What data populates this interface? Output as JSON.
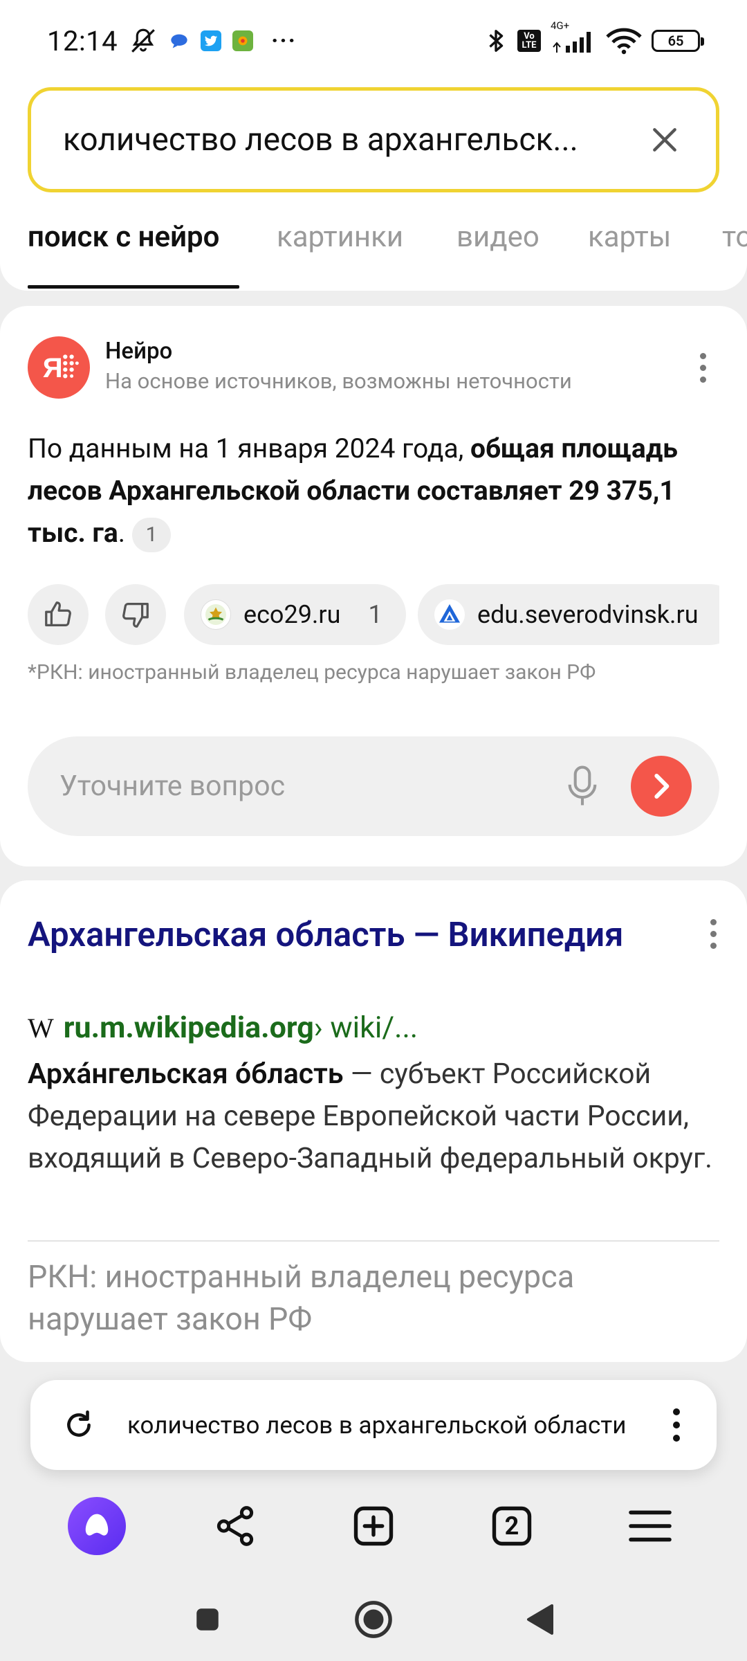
{
  "status_bar": {
    "time": "12:14",
    "net_volte": "Vo LTE",
    "net_type": "4G+",
    "battery": "65",
    "more": "···"
  },
  "search": {
    "query": "количество лесов в архангельск..."
  },
  "tabs": [
    {
      "label": "поиск с нейро"
    },
    {
      "label": "картинки"
    },
    {
      "label": "видео"
    },
    {
      "label": "карты"
    },
    {
      "label": "то"
    }
  ],
  "neuro": {
    "title": "Нейро",
    "subtitle": "На основе источников, возможны неточности",
    "answer_plain": "По данным на 1 января 2024 года, ",
    "answer_bold": "общая площадь лесов Архангельской области составляет 29 375,1 тыс. га",
    "answer_tail": ".",
    "citation": "1",
    "sources": [
      {
        "label": "eco29.ru",
        "count": "1"
      },
      {
        "label": "edu.severodvinsk.ru"
      }
    ],
    "rkn_note": "*РКН: иностранный владелец ресурса нарушает закон РФ",
    "refine_placeholder": "Уточните вопрос"
  },
  "result": {
    "title": "Архангельская область — Википедия",
    "url_domain": "ru.m.wikipedia.org",
    "url_path": " › wiki/...",
    "snippet_bold": "Арха́нгельская о́бласть",
    "snippet_rest": " — субъект Российской Федерации на севере Европейской части России, входящий в Северо-Западный федеральный округ.",
    "rkn_note": "РКН: иностранный владелец ресурса нарушает закон РФ"
  },
  "omnibox": {
    "text": "количество лесов в архангельской области"
  },
  "toolbar": {
    "tabs_count": "2"
  },
  "colors": {
    "accent_red": "#f4564a",
    "search_border": "#f0d332",
    "link_title": "#14147d",
    "link_url": "#1b6b1b",
    "alice_purple": "#7a3dff"
  },
  "icons": [
    "mute-icon",
    "chat-app-icon",
    "twitter-icon",
    "app-icon",
    "bluetooth-icon",
    "signal-icon",
    "wifi-icon",
    "battery-icon",
    "clear-icon",
    "kebab-menu-icon",
    "thumbs-up-icon",
    "thumbs-down-icon",
    "microphone-icon",
    "send-arrow-icon",
    "reload-icon",
    "alice-icon",
    "share-icon",
    "new-tab-icon",
    "tabs-counter-icon",
    "menu-icon",
    "recent-apps-icon",
    "home-icon",
    "back-icon"
  ]
}
